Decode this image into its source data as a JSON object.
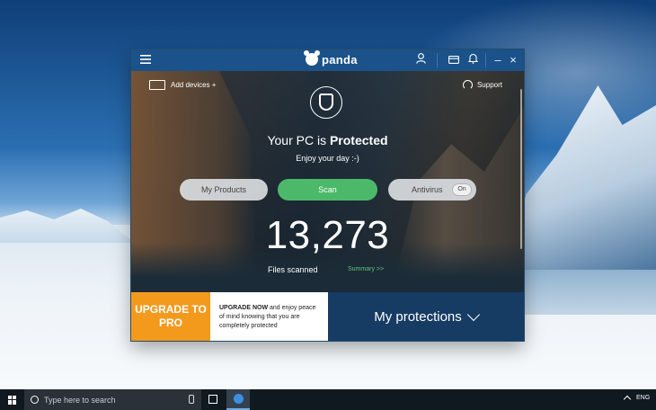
{
  "window": {
    "app_name": "panda",
    "menu_icon": "hamburger-icon",
    "account_icon": "user-icon",
    "card_icon": "card-icon",
    "notifications_icon": "bell-icon",
    "minimize_label": "–",
    "close_label": "×"
  },
  "hero": {
    "add_devices_label": "Add devices +",
    "support_label": "Support",
    "status_prefix": "Your PC is ",
    "status_emphasis": "Protected",
    "subtitle": "Enjoy your day :-)",
    "buttons": {
      "my_products": "My Products",
      "scan": "Scan",
      "antivirus": "Antivirus",
      "antivirus_toggle": "On"
    },
    "files_scanned_count": "13,273",
    "files_scanned_label": "Files scanned",
    "summary_link": "Summary >>"
  },
  "promo": {
    "upgrade_line1": "UPGRADE TO",
    "upgrade_line2": "PRO",
    "text_bold": "UPGRADE NOW",
    "text_rest": " and enjoy peace of mind knowing that you are completely protected",
    "my_protections": "My protections"
  },
  "taskbar": {
    "search_placeholder": "Type here to search",
    "language": "ENG"
  },
  "colors": {
    "accent_green": "#4cb96a",
    "upgrade_orange": "#f39a1d",
    "titlebar_blue": "#1a5289",
    "protections_blue": "#173c63"
  }
}
